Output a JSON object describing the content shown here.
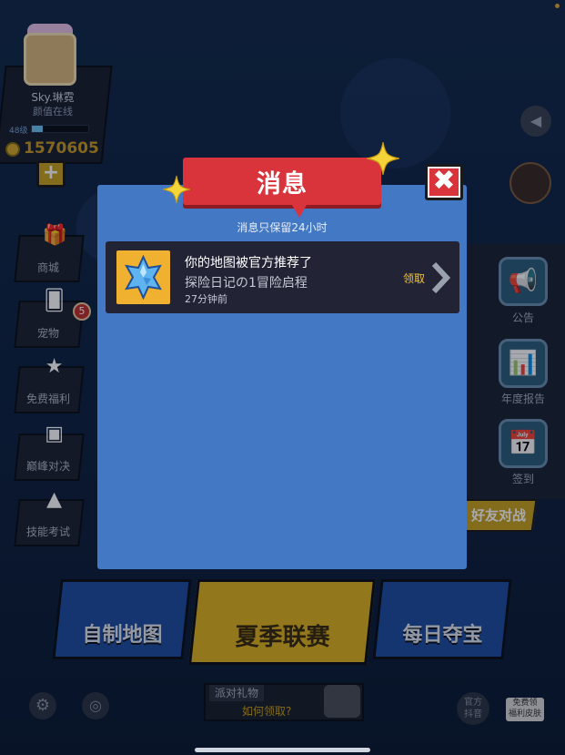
{
  "profile": {
    "username": "Sky.琳霓",
    "status": "颜值在线",
    "level_label": "48级",
    "level_progress": 0.2,
    "coins": "1570605",
    "add_label": "+"
  },
  "sidebar": {
    "items": [
      {
        "label": "商城",
        "icon": "gift-shop-icon"
      },
      {
        "label": "宠物",
        "icon": "pet-cards-icon",
        "badge": "5"
      },
      {
        "label": "免费福利",
        "icon": "coin-gift-icon"
      },
      {
        "label": "巅峰对决",
        "icon": "tv-icon"
      },
      {
        "label": "技能考试",
        "icon": "tent-icon"
      }
    ]
  },
  "right_panel": {
    "items": [
      {
        "label": "公告",
        "icon": "megaphone-icon"
      },
      {
        "label": "年度报告",
        "icon": "annual-report-icon"
      },
      {
        "label": "签到",
        "icon": "calendar-icon"
      }
    ],
    "friend_battle": "好友对战"
  },
  "modes": {
    "left": "自制地图",
    "center": "夏季联赛",
    "right": "每日夺宝"
  },
  "bottom": {
    "party_title": "派对礼物",
    "party_how": "如何领取?",
    "official_line1": "官方",
    "official_line2": "抖音",
    "free_skin_line1": "免费领",
    "free_skin_line2": "福利皮肤"
  },
  "modal": {
    "title": "消息",
    "close_label": "✖",
    "retention_note": "消息只保留24小时",
    "messages": [
      {
        "title": "你的地图被官方推荐了",
        "subtitle": "探险日记の1冒险启程",
        "time": "27分钟前",
        "action": "领取",
        "icon": "blue-crystal-icon"
      }
    ]
  },
  "colors": {
    "modal_bg": "#4378c4",
    "header_red": "#d9343c",
    "card_bg": "#222436",
    "claim_gold": "#f2c230",
    "thumb_orange": "#f0b030"
  }
}
